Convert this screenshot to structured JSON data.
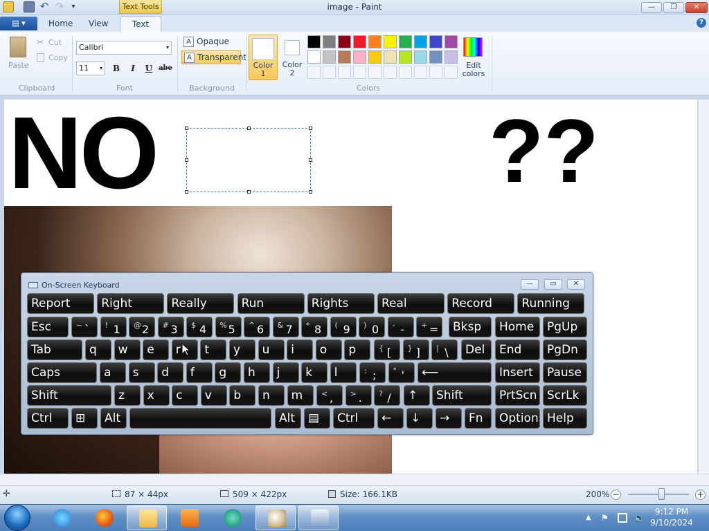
{
  "window": {
    "title": "image - Paint",
    "context_tab": "Text Tools",
    "btn_minimize": "—",
    "btn_maximize": "❐",
    "btn_close": "✕"
  },
  "tabs": {
    "file": "▤ ▾",
    "items": [
      "Home",
      "View",
      "Text"
    ],
    "help": "?"
  },
  "ribbon": {
    "clipboard": {
      "paste": "Paste",
      "cut": "Cut",
      "copy": "Copy",
      "label": "Clipboard"
    },
    "font": {
      "family": "Calibri",
      "size": "11",
      "bold": "B",
      "italic": "I",
      "underline": "U",
      "strike": "abe",
      "label": "Font"
    },
    "background": {
      "opaque": "Opaque",
      "transparent": "Transparent",
      "label": "Background"
    },
    "colors": {
      "color1": "Color\n1",
      "color1_value": "#ffffff",
      "color2": "Color\n2",
      "color2_value": "#ffffff",
      "edit": "Edit\ncolors",
      "label": "Colors",
      "row1": [
        "#000000",
        "#7f7f7f",
        "#880015",
        "#ed1c24",
        "#ff7f27",
        "#fff200",
        "#22b14c",
        "#00a2e8",
        "#3f48cc",
        "#a349a4"
      ],
      "row2": [
        "#ffffff",
        "#c3c3c3",
        "#b97a57",
        "#ffaec9",
        "#ffc90e",
        "#efe4b0",
        "#b5e61d",
        "#99d9ea",
        "#7092be",
        "#c8bfe7"
      ]
    }
  },
  "canvas": {
    "text_no": "NO",
    "text_qq": "??"
  },
  "osk": {
    "title": "On-Screen Keyboard",
    "btn_min": "—",
    "btn_max": "▭",
    "btn_close": "✕",
    "predictions": [
      "Report",
      "Right",
      "Really",
      "Run",
      "Rights",
      "Real",
      "Record",
      "Running"
    ],
    "row1_symbols": [
      {
        "shift": "~",
        "main": "`"
      },
      {
        "shift": "!",
        "main": "1"
      },
      {
        "shift": "@",
        "main": "2"
      },
      {
        "shift": "#",
        "main": "3"
      },
      {
        "shift": "$",
        "main": "4"
      },
      {
        "shift": "%",
        "main": "5"
      },
      {
        "shift": "^",
        "main": "6"
      },
      {
        "shift": "&",
        "main": "7"
      },
      {
        "shift": "*",
        "main": "8"
      },
      {
        "shift": "(",
        "main": "9"
      },
      {
        "shift": ")",
        "main": "0"
      },
      {
        "shift": "-",
        "main": "-"
      },
      {
        "shift": "+",
        "main": "="
      }
    ],
    "keys": {
      "esc": "Esc",
      "bksp": "Bksp",
      "home": "Home",
      "pgup": "PgUp",
      "tab": "Tab",
      "del": "Del",
      "end": "End",
      "pgdn": "PgDn",
      "caps": "Caps",
      "enter": "⟵",
      "insert": "Insert",
      "pause": "Pause",
      "shift": "Shift",
      "up": "↑",
      "prtscn": "PrtScn",
      "scrlk": "ScrLk",
      "ctrl": "Ctrl",
      "win": "⊞",
      "alt": "Alt",
      "menu": "▤",
      "left": "←",
      "down": "↓",
      "right": "→",
      "fn": "Fn",
      "options": "Options",
      "help": "Help"
    },
    "row2_letters": [
      "q",
      "w",
      "e",
      "r",
      "t",
      "y",
      "u",
      "i",
      "o",
      "p"
    ],
    "row2_symbols": [
      {
        "shift": "{",
        "main": "["
      },
      {
        "shift": "}",
        "main": "]"
      },
      {
        "shift": "|",
        "main": "\\"
      }
    ],
    "row3_letters": [
      "a",
      "s",
      "d",
      "f",
      "g",
      "h",
      "j",
      "k",
      "l"
    ],
    "row3_symbols": [
      {
        "shift": ":",
        "main": ";"
      },
      {
        "shift": "\"",
        "main": "'"
      }
    ],
    "row4_letters": [
      "z",
      "x",
      "c",
      "v",
      "b",
      "n",
      "m"
    ],
    "row4_symbols": [
      {
        "shift": "<",
        "main": ","
      },
      {
        "shift": ">",
        "main": "."
      },
      {
        "shift": "?",
        "main": "/"
      }
    ]
  },
  "status": {
    "selection": "87 × 44px",
    "canvas_size": "509 × 422px",
    "file_size": "Size: 166.1KB",
    "zoom": "200%",
    "zoom_minus": "−",
    "zoom_plus": "+"
  },
  "taskbar": {
    "time": "9:12 PM",
    "date": "9/10/2024",
    "items": [
      "internet-explorer",
      "firefox",
      "file-explorer",
      "media-player",
      "network-app",
      "paint",
      "printer-app"
    ]
  }
}
